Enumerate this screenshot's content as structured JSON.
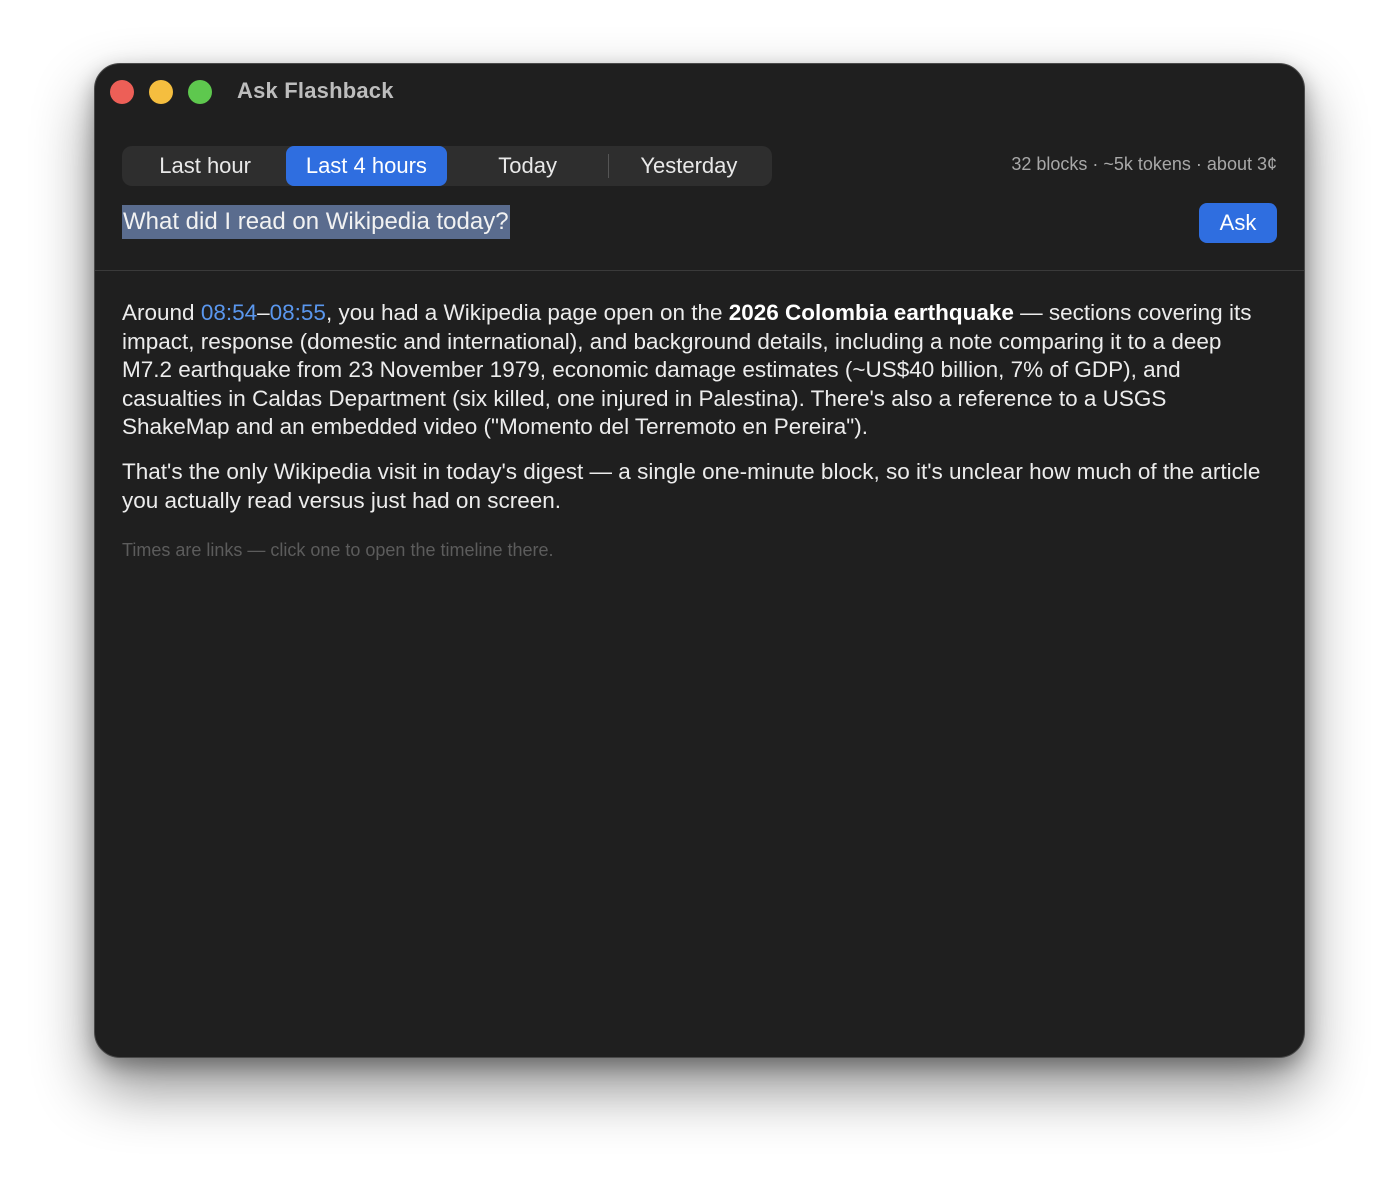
{
  "window": {
    "title": "Ask Flashback"
  },
  "range_tabs": {
    "items": [
      {
        "label": "Last hour",
        "active": false
      },
      {
        "label": "Last 4 hours",
        "active": true
      },
      {
        "label": "Today",
        "active": false
      },
      {
        "label": "Yesterday",
        "active": false
      }
    ]
  },
  "stats": {
    "text": "32 blocks · ~5k tokens · about 3¢"
  },
  "query": {
    "value": "What did I read on Wikipedia today?"
  },
  "ask_button": {
    "label": "Ask"
  },
  "answer": {
    "p1_prefix": "Around ",
    "time_start": "08:54",
    "time_dash": "–",
    "time_end": "08:55",
    "p1_mid": ", you had a Wikipedia page open on the ",
    "p1_bold": "2026 Colombia earthquake",
    "p1_rest": " — sections covering its impact, response (domestic and international), and background details, including a note comparing it to a deep M7.2 earthquake from 23 November 1979, economic damage estimates (~US$40 billion, 7% of GDP), and casualties in Caldas Department (six killed, one injured in Palestina). There's also a reference to a USGS ShakeMap and an embedded video (\"Momento del Terremoto en Pereira\").",
    "p2": "That's the only Wikipedia visit in today's digest — a single one-minute block, so it's unclear how much of the article you actually read versus just had on screen."
  },
  "hint": {
    "text": "Times are links — click one to open the timeline there."
  },
  "colors": {
    "accent": "#2f6ee0",
    "link": "#5a97ee",
    "window_bg": "#1f1f1f",
    "selection": "#5a6c8e"
  }
}
